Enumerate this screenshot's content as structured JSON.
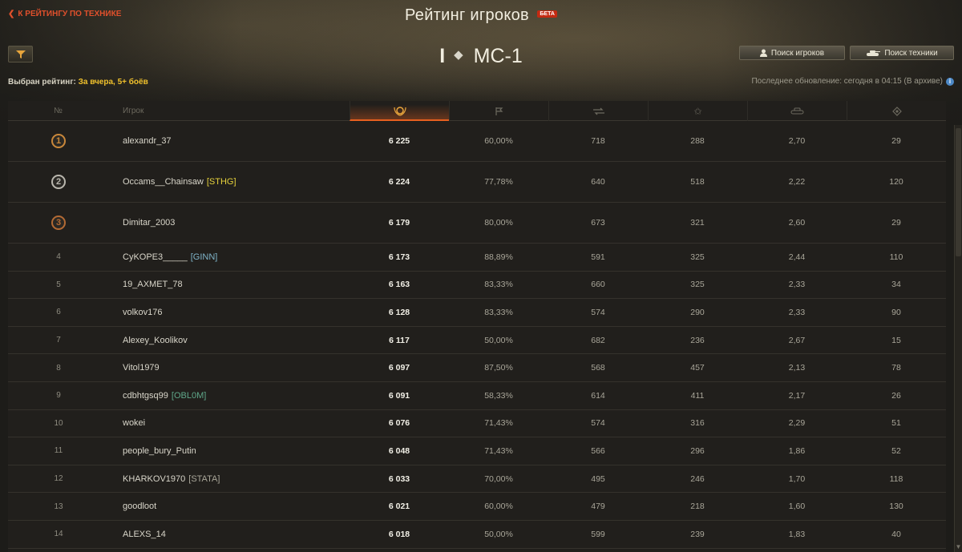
{
  "header": {
    "back_link": "К РЕЙТИНГУ ПО ТЕХНИКЕ",
    "title": "Рейтинг игроков",
    "beta_badge": "БЕТА",
    "vehicle_tier": "I",
    "vehicle_type_icon": "light-tank-icon",
    "vehicle_name": "МС-1",
    "search_players_label": "Поиск игроков",
    "search_vehicles_label": "Поиск техники",
    "selected_rating_label": "Выбран рейтинг:",
    "selected_rating_value": "За вчера, 5+ боёв",
    "last_update": "Последнее обновление: сегодня в 04:15 (В архиве)",
    "accent_color": "#e8601f"
  },
  "table": {
    "headers": {
      "rank": "№",
      "player": "Игрок",
      "score_icon": "rating-laurel-icon",
      "winrate_icon": "flag-icon",
      "damage_icon": "damage-icon",
      "xp_icon": "star-icon",
      "frags_icon": "tank-icon",
      "battles_icon": "battles-icon"
    },
    "rows": [
      {
        "rank": "1",
        "player": "alexandr_37",
        "clan": "",
        "clan_color": "",
        "score": "6 225",
        "winrate": "60,00%",
        "damage": "718",
        "xp": "288",
        "frags": "2,70",
        "battles": "29",
        "medal": "gold"
      },
      {
        "rank": "2",
        "player": "Occams__Chainsaw",
        "clan": "[STHG]",
        "clan_color": "#e6d23c",
        "score": "6 224",
        "winrate": "77,78%",
        "damage": "640",
        "xp": "518",
        "frags": "2,22",
        "battles": "120",
        "medal": "silver"
      },
      {
        "rank": "3",
        "player": "Dimitar_2003",
        "clan": "",
        "clan_color": "",
        "score": "6 179",
        "winrate": "80,00%",
        "damage": "673",
        "xp": "321",
        "frags": "2,60",
        "battles": "29",
        "medal": "bronze"
      },
      {
        "rank": "4",
        "player": "CyKOPE3_____",
        "clan": "[GINN]",
        "clan_color": "#7fb4c9",
        "score": "6 173",
        "winrate": "88,89%",
        "damage": "591",
        "xp": "325",
        "frags": "2,44",
        "battles": "110",
        "medal": ""
      },
      {
        "rank": "5",
        "player": "19_AXMET_78",
        "clan": "",
        "clan_color": "",
        "score": "6 163",
        "winrate": "83,33%",
        "damage": "660",
        "xp": "325",
        "frags": "2,33",
        "battles": "34",
        "medal": ""
      },
      {
        "rank": "6",
        "player": "volkov176",
        "clan": "",
        "clan_color": "",
        "score": "6 128",
        "winrate": "83,33%",
        "damage": "574",
        "xp": "290",
        "frags": "2,33",
        "battles": "90",
        "medal": ""
      },
      {
        "rank": "7",
        "player": "Alexey_Koolikov",
        "clan": "",
        "clan_color": "",
        "score": "6 117",
        "winrate": "50,00%",
        "damage": "682",
        "xp": "236",
        "frags": "2,67",
        "battles": "15",
        "medal": ""
      },
      {
        "rank": "8",
        "player": "Vitol1979",
        "clan": "",
        "clan_color": "",
        "score": "6 097",
        "winrate": "87,50%",
        "damage": "568",
        "xp": "457",
        "frags": "2,13",
        "battles": "78",
        "medal": ""
      },
      {
        "rank": "9",
        "player": "cdbhtgsq99",
        "clan": "[OBL0M]",
        "clan_color": "#5fa88a",
        "score": "6 091",
        "winrate": "58,33%",
        "damage": "614",
        "xp": "411",
        "frags": "2,17",
        "battles": "26",
        "medal": ""
      },
      {
        "rank": "10",
        "player": "wokei",
        "clan": "",
        "clan_color": "",
        "score": "6 076",
        "winrate": "71,43%",
        "damage": "574",
        "xp": "316",
        "frags": "2,29",
        "battles": "51",
        "medal": ""
      },
      {
        "rank": "11",
        "player": "people_bury_Putin",
        "clan": "",
        "clan_color": "",
        "score": "6 048",
        "winrate": "71,43%",
        "damage": "566",
        "xp": "296",
        "frags": "1,86",
        "battles": "52",
        "medal": ""
      },
      {
        "rank": "12",
        "player": "KHARKOV1970",
        "clan": "[STATA]",
        "clan_color": "#a9a699",
        "score": "6 033",
        "winrate": "70,00%",
        "damage": "495",
        "xp": "246",
        "frags": "1,70",
        "battles": "118",
        "medal": ""
      },
      {
        "rank": "13",
        "player": "goodloot",
        "clan": "",
        "clan_color": "",
        "score": "6 021",
        "winrate": "60,00%",
        "damage": "479",
        "xp": "218",
        "frags": "1,60",
        "battles": "130",
        "medal": ""
      },
      {
        "rank": "14",
        "player": "ALEXS_14",
        "clan": "",
        "clan_color": "",
        "score": "6 018",
        "winrate": "50,00%",
        "damage": "599",
        "xp": "239",
        "frags": "1,83",
        "battles": "40",
        "medal": ""
      }
    ]
  }
}
